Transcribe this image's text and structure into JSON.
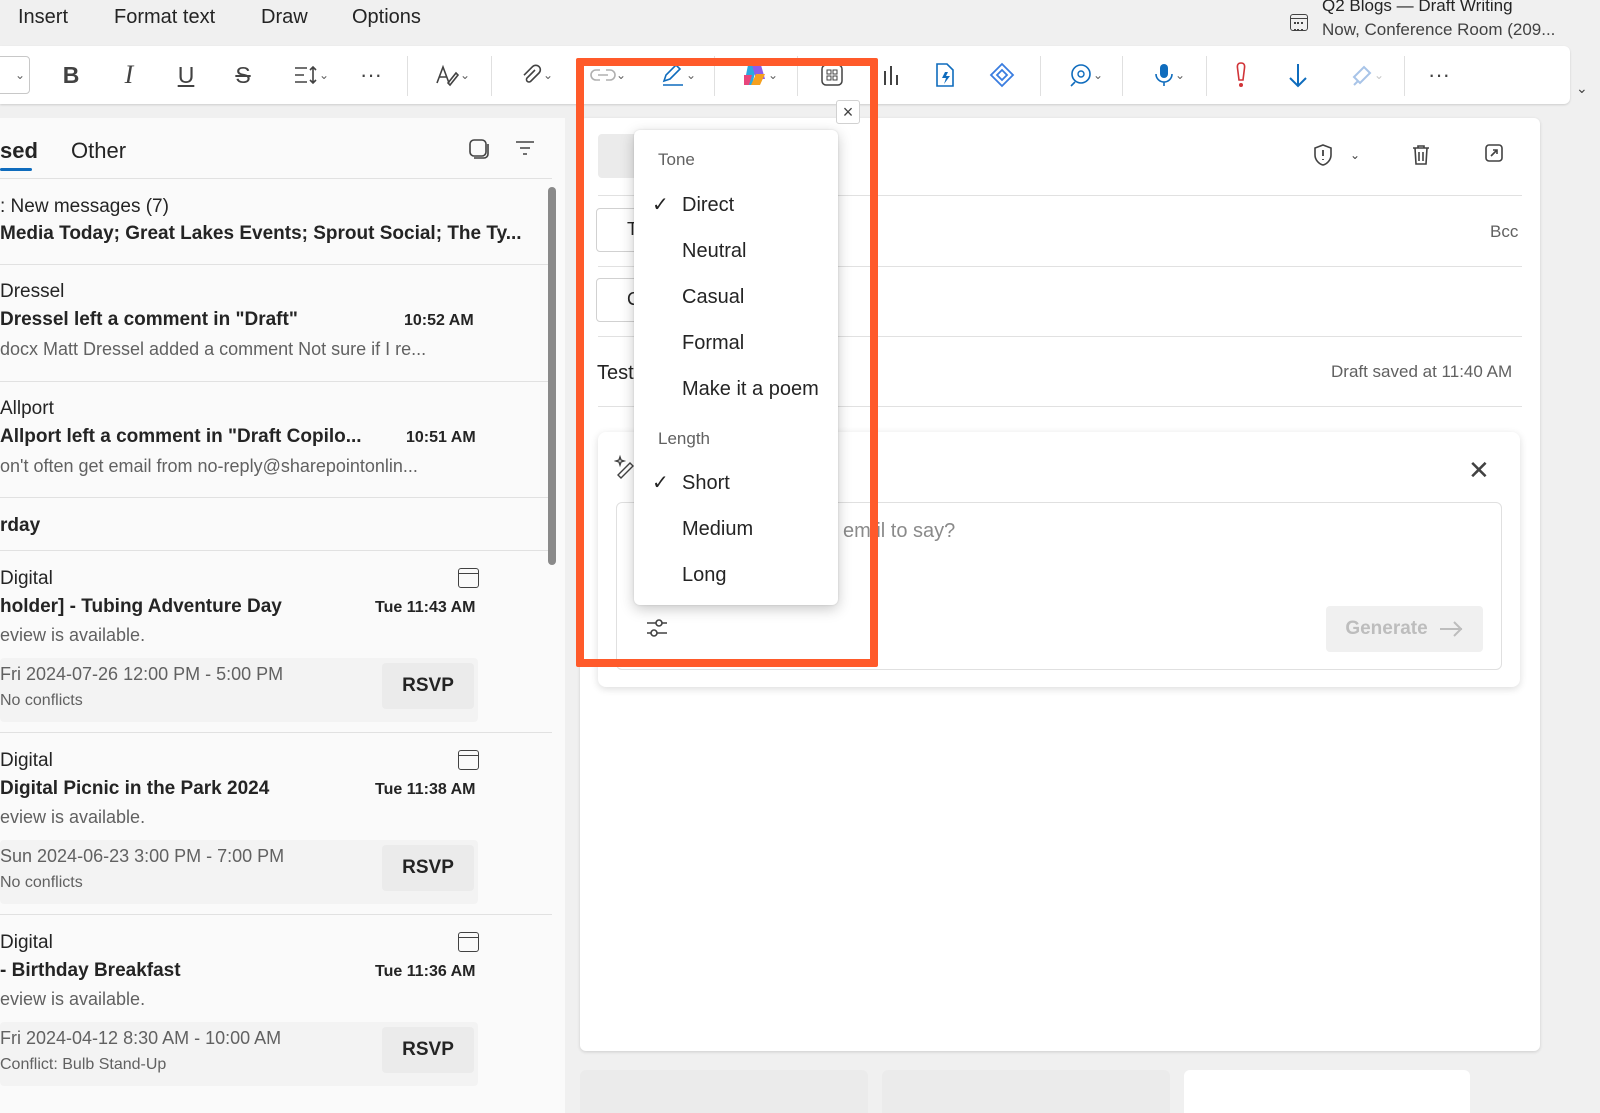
{
  "menubar": {
    "items": [
      "Insert",
      "Format text",
      "Draw",
      "Options"
    ]
  },
  "meeting": {
    "title": "Q2 Blogs — Draft Writing",
    "subtitle": "Now, Conference Room (209..."
  },
  "toolbar": {
    "bold": "B",
    "italic": "I",
    "underline": "U",
    "strikethrough": "S",
    "more": "···"
  },
  "mail_list": {
    "tabs": {
      "focused": "sed",
      "other": "Other"
    },
    "group1": {
      "sender": ": New messages (7)",
      "subject": " Media Today; Great Lakes Events; Sprout Social; The Ty..."
    },
    "item1": {
      "sender": "Dressel",
      "subject": "Dressel left a comment in \"Draft\"",
      "time": "10:52 AM",
      "preview": "docx Matt Dressel added a comment Not sure if I re..."
    },
    "item2": {
      "sender": " Allport",
      "subject": " Allport left a comment in \"Draft Copilo...",
      "time": "10:51 AM",
      "preview": "on't often get email from no-reply@sharepointonlin..."
    },
    "section": "rday",
    "events": [
      {
        "sender": "Digital",
        "subject": "holder] - Tubing Adventure Day",
        "time": "Tue 11:43 AM",
        "preview": "eview is available.",
        "date": "Fri 2024-07-26 12:00 PM - 5:00 PM",
        "conflict": "No conflicts",
        "rsvp": "RSVP"
      },
      {
        "sender": "Digital",
        "subject": "Digital Picnic in the Park 2024",
        "time": "Tue 11:38 AM",
        "preview": "eview is available.",
        "date": "Sun 2024-06-23 3:00 PM - 7:00 PM",
        "conflict": "No conflicts",
        "rsvp": "RSVP"
      },
      {
        "sender": "Digital",
        "subject": "- Birthday Breakfast",
        "time": "Tue 11:36 AM",
        "preview": "eview is available.",
        "date": "Fri 2024-04-12 8:30 AM - 10:00 AM",
        "conflict": "Conflict: Bulb Stand-Up",
        "rsvp": "RSVP"
      }
    ]
  },
  "compose": {
    "to_stub": "T",
    "cc_stub": "C",
    "bcc": "Bcc",
    "subject": "Test",
    "draft_saved": "Draft saved at 11:40 AM"
  },
  "copilot": {
    "placeholder": "em il to say?",
    "generate": "Generate"
  },
  "dropdown": {
    "tone_header": "Tone",
    "tone_options": [
      {
        "label": "Direct",
        "checked": true
      },
      {
        "label": "Neutral",
        "checked": false
      },
      {
        "label": "Casual",
        "checked": false
      },
      {
        "label": "Formal",
        "checked": false
      },
      {
        "label": "Make it a poem",
        "checked": false
      }
    ],
    "length_header": "Length",
    "length_options": [
      {
        "label": "Short",
        "checked": true
      },
      {
        "label": "Medium",
        "checked": false
      },
      {
        "label": "Long",
        "checked": false
      }
    ],
    "check_glyph": "✓"
  },
  "colors": {
    "highlight": "#ff5a2a",
    "accent": "#0f6cbd"
  }
}
